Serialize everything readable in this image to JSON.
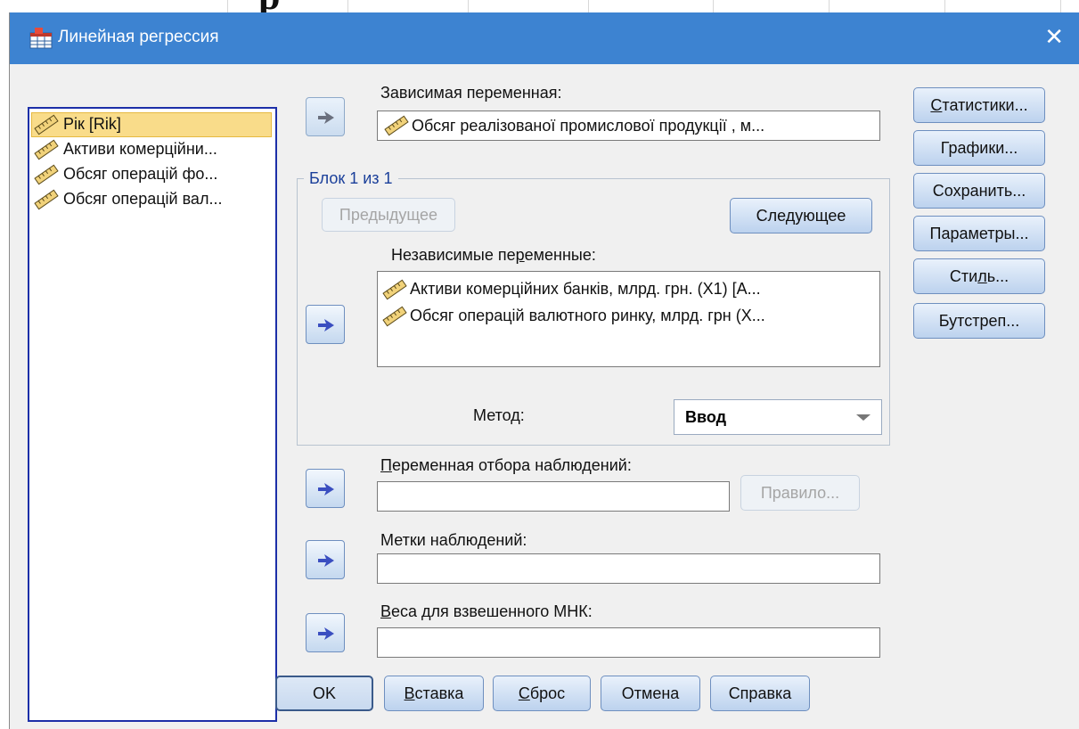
{
  "window": {
    "title": "Линейная регрессия",
    "close_glyph": "✕"
  },
  "background_fragment": "р",
  "source_variables": [
    {
      "label": "Рік [Rik]",
      "selected": true,
      "icon": "scale-ruler-icon"
    },
    {
      "label": "Активи комерційни...",
      "selected": false,
      "icon": "scale-ruler-icon"
    },
    {
      "label": "Обсяг операцій фо...",
      "selected": false,
      "icon": "scale-ruler-icon"
    },
    {
      "label": "Обсяг операцій вал...",
      "selected": false,
      "icon": "scale-ruler-icon"
    }
  ],
  "dependent": {
    "label": "Зависимая переменная:",
    "value": "Обсяг реалізованої промислової продукції , м..."
  },
  "block": {
    "title": "Блок 1 из 1",
    "prev_label": "Предыдущее",
    "next_label": "Следующее",
    "independents_label": "Независимые переменные:",
    "independents": [
      "Активи комерційних банків, млрд. грн. (X1) [A...",
      "Обсяг операцій валютного ринку, млрд. грн (X..."
    ],
    "method_label": "Метод:",
    "method_value": "Ввод"
  },
  "selection": {
    "label": "Переменная отбора наблюдений:",
    "value": "",
    "rule_label": "Правило..."
  },
  "case_labels": {
    "label": "Метки наблюдений:",
    "value": ""
  },
  "wls": {
    "label": "Веса для взвешенного МНК:",
    "value": ""
  },
  "side_buttons": [
    "Статистики...",
    "Графики...",
    "Сохранить...",
    "Параметры...",
    "Стиль...",
    "Бутстреп..."
  ],
  "bottom_buttons": [
    "OK",
    "Вставка",
    "Сброс",
    "Отмена",
    "Справка"
  ],
  "colors": {
    "titlebar": "#3d83d1",
    "selection": "#f9dc8a",
    "source_border": "#1c2fa8",
    "arrow": "#3a4ec0"
  }
}
